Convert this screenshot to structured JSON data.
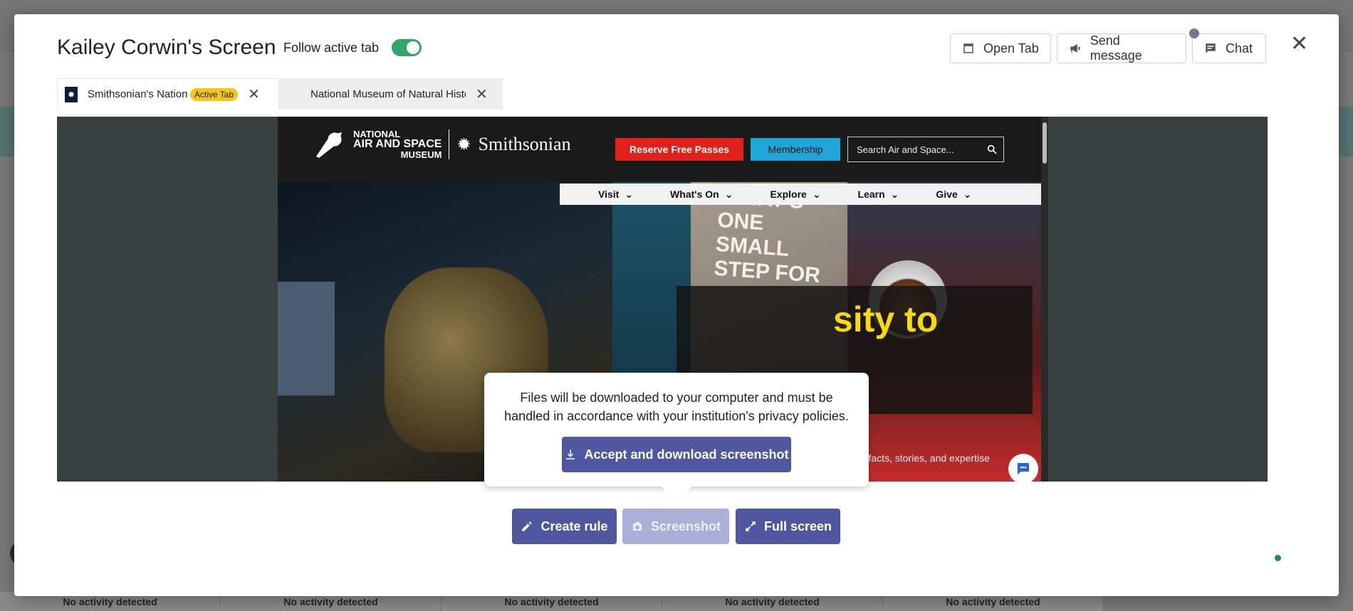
{
  "background": {
    "cards": [
      "No activity detected",
      "No activity detected",
      "No activity detected",
      "No activity detected",
      "No activity detected"
    ]
  },
  "modal": {
    "title": "Kailey Corwin's Screen",
    "follow_label": "Follow active tab",
    "follow_on": true,
    "buttons": {
      "open_tab": "Open Tab",
      "send_message": "Send message",
      "chat": "Chat"
    },
    "close_symbol": "✕",
    "tabs": [
      {
        "title": "Smithsonian's National Air and Space Museum",
        "badge": "Active Tab"
      },
      {
        "title": "National Museum of Natural History"
      }
    ]
  },
  "site": {
    "logo_line1": "NATIONAL",
    "logo_line2": "AIR AND SPACE",
    "logo_line3": "MUSEUM",
    "logo_brand": "Smithsonian",
    "reserve": "Reserve Free Passes",
    "membership": "Membership",
    "search_placeholder": "Search Air and Space...",
    "nav": [
      "Visit",
      "What's On",
      "Explore",
      "Learn",
      "Give"
    ],
    "wall_quote": "\"THAT'S ONE SMALL STEP FOR",
    "hero_heading": "sity to",
    "hero_sub": "artifacts, stories, and expertise"
  },
  "popover": {
    "text": "Files will be downloaded to your computer and must be handled in accordance with your institution's privacy policies.",
    "accept": "Accept and download screenshot"
  },
  "actions": {
    "create_rule": "Create rule",
    "screenshot": "Screenshot",
    "full_screen": "Full screen"
  },
  "colors": {
    "primary": "#4e57a0",
    "toggle_on": "#34a56a",
    "badge": "#f5c518",
    "reserve": "#e0201b",
    "membership": "#1fa6d6",
    "hero_heading": "#f5d915"
  }
}
